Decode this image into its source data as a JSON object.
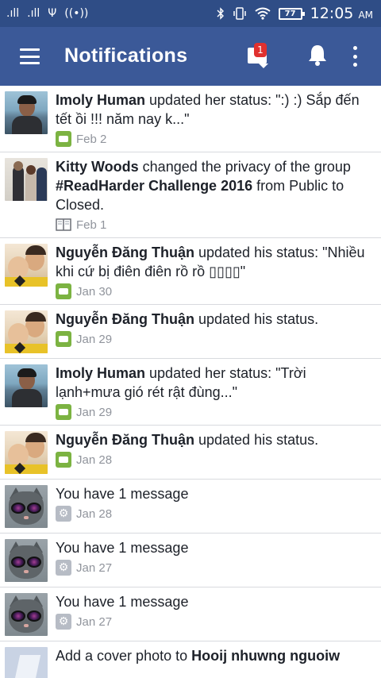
{
  "status_bar": {
    "signal1": ".ıll",
    "signal2": ".ıll",
    "usb": "Ψ",
    "hotspot": "((•))",
    "battery": "77",
    "time": "12:05",
    "ampm": "AM"
  },
  "app_bar": {
    "title": "Notifications",
    "friend_request_badge": "1"
  },
  "notifications": [
    {
      "actor": "Imoly Human",
      "text": " updated her status: \":) :) Sắp đến tết ồi !!! năm nay k...\"",
      "icon": "status-icon",
      "date": "Feb 2",
      "avatar": "man"
    },
    {
      "actor": "Kitty Woods",
      "text": " changed the privacy of the group ",
      "target": "#ReadHarder Challenge 2016",
      "text2": " from Public to Closed.",
      "icon": "group-book-icon",
      "date": "Feb 1",
      "avatar": "couple"
    },
    {
      "actor": "Nguyễn Đăng Thuận",
      "text": " updated his status: \"Nhiều khi cứ bị điên điên rồ rồ ▯▯▯▯\"",
      "icon": "status-icon",
      "date": "Jan 30",
      "avatar": "kid"
    },
    {
      "actor": "Nguyễn Đăng Thuận",
      "text": " updated his status.",
      "icon": "status-icon",
      "date": "Jan 29",
      "avatar": "kid"
    },
    {
      "actor": "Imoly Human",
      "text": " updated her status: \"Trời lạnh+mưa gió rét rật đùng...\"",
      "icon": "status-icon",
      "date": "Jan 29",
      "avatar": "man"
    },
    {
      "actor": "Nguyễn Đăng Thuận",
      "text": " updated his status.",
      "icon": "status-icon",
      "date": "Jan 28",
      "avatar": "kid"
    },
    {
      "text": "You have 1 message",
      "icon": "gear-icon",
      "date": "Jan 28",
      "avatar": "cat"
    },
    {
      "text": "You have 1 message",
      "icon": "gear-icon",
      "date": "Jan 27",
      "avatar": "cat"
    },
    {
      "text": "You have 1 message",
      "icon": "gear-icon",
      "date": "Jan 27",
      "avatar": "cat"
    },
    {
      "text": "Add a cover photo to ",
      "target": "Hooij nhuwng nguoiw",
      "avatar": "cover"
    }
  ],
  "colors": {
    "status_bar": "#2f4d86",
    "app_bar": "#3b5998",
    "status_icon": "#7cb342",
    "badge": "#e0312f"
  }
}
